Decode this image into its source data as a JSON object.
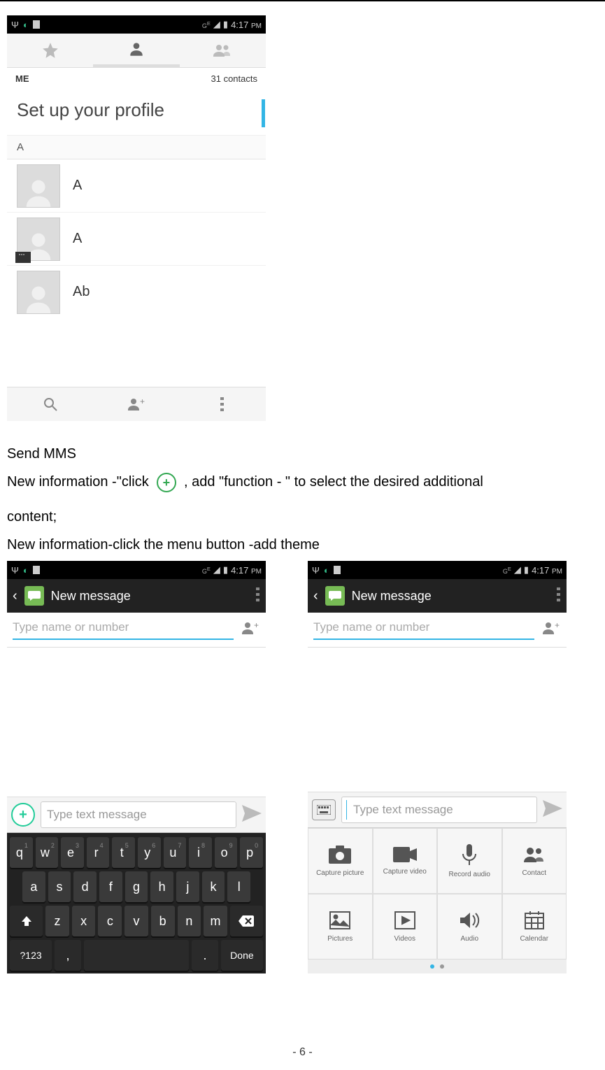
{
  "status": {
    "time": "4:17",
    "ampm": "PM",
    "net": "G",
    "e": "E"
  },
  "contacts": {
    "me": "ME",
    "count": "31 contacts",
    "profile": "Set up your profile",
    "section": "A",
    "rows": [
      "A",
      "A",
      "Ab"
    ]
  },
  "text": {
    "h": "Send MMS",
    "l1a": "New information -\"click",
    "l1b": ",    add \"function - \" to select the desired additional",
    "l2": "content;",
    "l3": "New information-click the menu button -add theme"
  },
  "msg": {
    "title": "New message",
    "to_placeholder": "Type name or number",
    "msg_placeholder": "Type text message"
  },
  "kb": {
    "r1": [
      "q",
      "w",
      "e",
      "r",
      "t",
      "y",
      "u",
      "i",
      "o",
      "p"
    ],
    "nums": [
      "1",
      "2",
      "3",
      "4",
      "5",
      "6",
      "7",
      "8",
      "9",
      "0"
    ],
    "r2": [
      "a",
      "s",
      "d",
      "f",
      "g",
      "h",
      "j",
      "k",
      "l"
    ],
    "r3": [
      "z",
      "x",
      "c",
      "v",
      "b",
      "n",
      "m"
    ],
    "sym": "?123",
    "done": "Done",
    "comma": ",",
    "period": "."
  },
  "att": {
    "r1": [
      "Capture picture",
      "Capture video",
      "Record audio",
      "Contact"
    ],
    "r2": [
      "Pictures",
      "Videos",
      "Audio",
      "Calendar"
    ]
  },
  "pagenum": "- 6 -"
}
